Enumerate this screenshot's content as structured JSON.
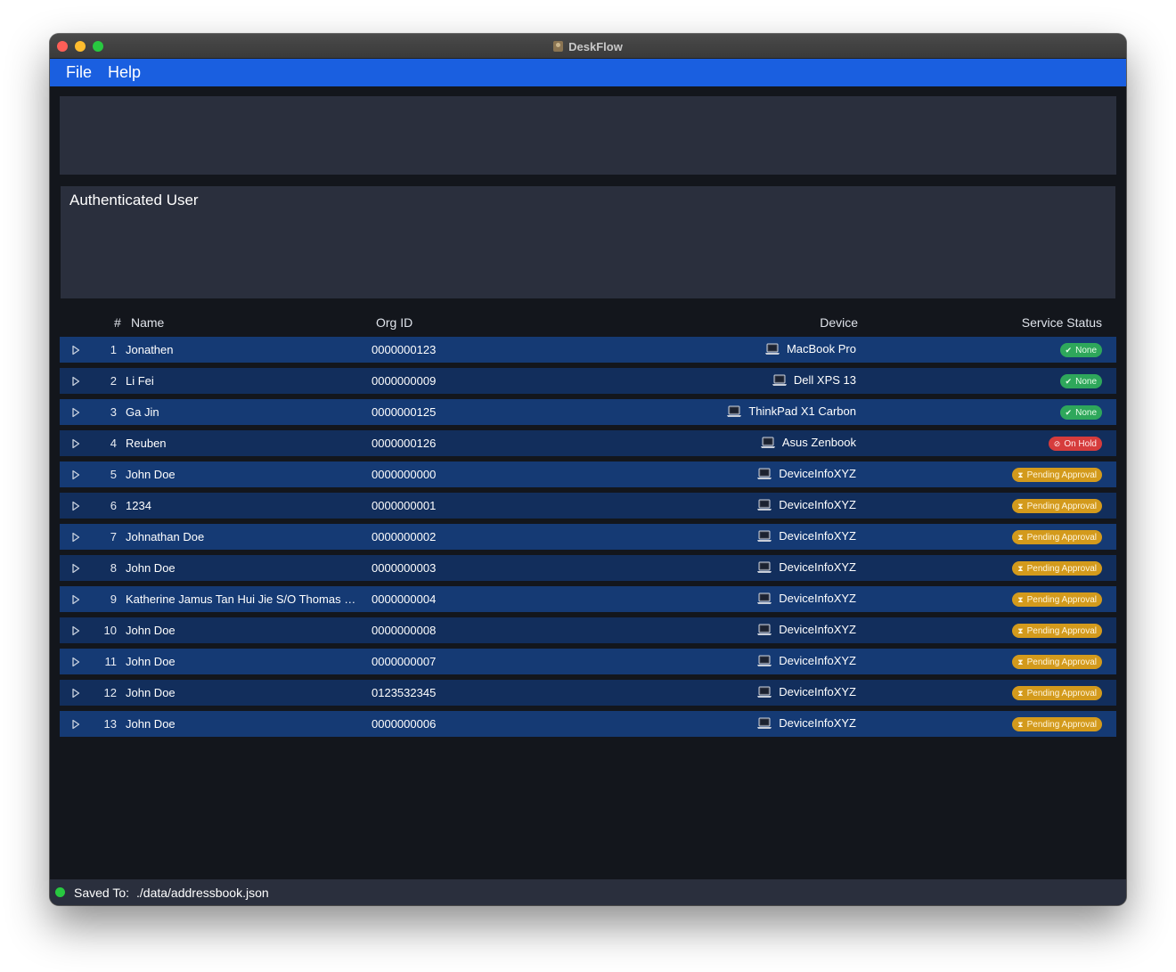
{
  "window": {
    "title": "DeskFlow"
  },
  "menu": {
    "file": "File",
    "help": "Help"
  },
  "auth_panel": {
    "title": "Authenticated User"
  },
  "table": {
    "columns": {
      "num": "#",
      "name": "Name",
      "org": "Org ID",
      "device": "Device",
      "status": "Service Status"
    },
    "rows": [
      {
        "idx": "1",
        "name": "Jonathen",
        "org": "0000000123",
        "device": "MacBook Pro",
        "status": "None",
        "kind": "none"
      },
      {
        "idx": "2",
        "name": "Li Fei",
        "org": "0000000009",
        "device": "Dell XPS 13",
        "status": "None",
        "kind": "none"
      },
      {
        "idx": "3",
        "name": "Ga Jin",
        "org": "0000000125",
        "device": "ThinkPad X1 Carbon",
        "status": "None",
        "kind": "none"
      },
      {
        "idx": "4",
        "name": "Reuben",
        "org": "0000000126",
        "device": "Asus Zenbook",
        "status": "On Hold",
        "kind": "hold"
      },
      {
        "idx": "5",
        "name": "John Doe",
        "org": "0000000000",
        "device": "DeviceInfoXYZ",
        "status": "Pending Approval",
        "kind": "pending"
      },
      {
        "idx": "6",
        "name": "1234",
        "org": "0000000001",
        "device": "DeviceInfoXYZ",
        "status": "Pending Approval",
        "kind": "pending"
      },
      {
        "idx": "7",
        "name": "Johnathan Doe",
        "org": "0000000002",
        "device": "DeviceInfoXYZ",
        "status": "Pending Approval",
        "kind": "pending"
      },
      {
        "idx": "8",
        "name": "John Doe",
        "org": "0000000003",
        "device": "DeviceInfoXYZ",
        "status": "Pending Approval",
        "kind": "pending"
      },
      {
        "idx": "9",
        "name": "Katherine Jamus Tan Hui Jie S/O Thomas Way...",
        "org": "0000000004",
        "device": "DeviceInfoXYZ",
        "status": "Pending Approval",
        "kind": "pending"
      },
      {
        "idx": "10",
        "name": "John Doe",
        "org": "0000000008",
        "device": "DeviceInfoXYZ",
        "status": "Pending Approval",
        "kind": "pending"
      },
      {
        "idx": "11",
        "name": "John Doe",
        "org": "0000000007",
        "device": "DeviceInfoXYZ",
        "status": "Pending Approval",
        "kind": "pending"
      },
      {
        "idx": "12",
        "name": "John Doe",
        "org": "0123532345",
        "device": "DeviceInfoXYZ",
        "status": "Pending Approval",
        "kind": "pending"
      },
      {
        "idx": "13",
        "name": "John Doe",
        "org": "0000000006",
        "device": "DeviceInfoXYZ",
        "status": "Pending Approval",
        "kind": "pending"
      }
    ]
  },
  "status_icons": {
    "none": "check-icon",
    "hold": "stop-icon",
    "pending": "hourglass-icon"
  },
  "statusbar": {
    "label": "Saved To:",
    "path": "./data/addressbook.json"
  },
  "colors": {
    "menubar": "#1a5fe0",
    "row": "#153a74",
    "none": "#2ea75b",
    "hold": "#d63c3c",
    "pending": "#d39a1c",
    "saved_dot": "#28c840"
  }
}
